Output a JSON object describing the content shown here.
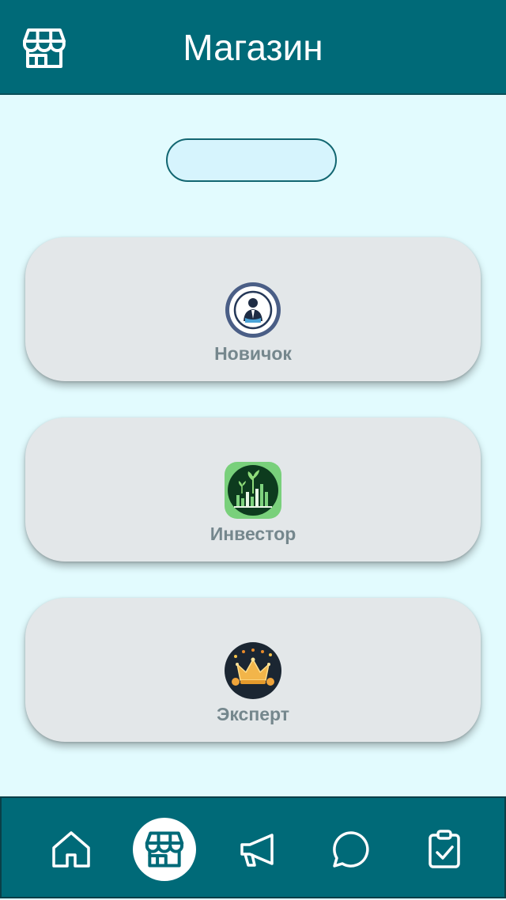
{
  "header": {
    "title": "Магазин",
    "icon": "store-icon"
  },
  "balance": {
    "value": ""
  },
  "plans": [
    {
      "label": "Новичок",
      "icon": "businessman-icon"
    },
    {
      "label": "Инвестор",
      "icon": "growth-chart-icon"
    },
    {
      "label": "Эксперт",
      "icon": "crown-icon"
    }
  ],
  "bottom_nav": {
    "items": [
      {
        "icon": "home-icon",
        "active": false
      },
      {
        "icon": "store-icon",
        "active": true
      },
      {
        "icon": "megaphone-icon",
        "active": false
      },
      {
        "icon": "chat-bubble-icon",
        "active": false
      },
      {
        "icon": "clipboard-check-icon",
        "active": false
      }
    ]
  },
  "colors": {
    "primary": "#006a78",
    "background": "#e2fbfe",
    "card": "#e3e7e9",
    "label": "#75878d"
  }
}
